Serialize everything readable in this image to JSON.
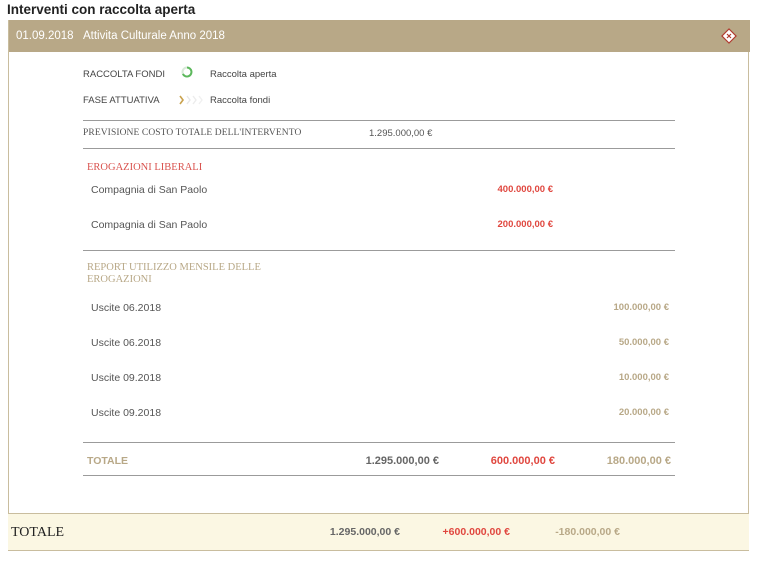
{
  "page_title": "Interventi con raccolta aperta",
  "card": {
    "date": "01.09.2018",
    "title": "Attivita Culturale Anno 2018",
    "status_rows": [
      {
        "label": "RACCOLTA FONDI",
        "value": "Raccolta aperta",
        "icon": "progress-ring-icon"
      },
      {
        "label": "FASE ATTUATIVA",
        "value": "Raccolta fondi",
        "icon": "chevron-steps-icon"
      }
    ],
    "forecast": {
      "label": "PREVISIONE COSTO TOTALE DELL'INTERVENTO",
      "value": "1.295.000,00 €"
    },
    "donations": {
      "title": "EROGAZIONI LIBERALI",
      "items": [
        {
          "label": "Compagnia di San Paolo",
          "amount": "400.000,00 €"
        },
        {
          "label": "Compagnia di San Paolo",
          "amount": "200.000,00 €"
        }
      ]
    },
    "report": {
      "title": "REPORT UTILIZZO MENSILE DELLE EROGAZIONI",
      "items": [
        {
          "label": "Uscite 06.2018",
          "amount": "100.000,00 €"
        },
        {
          "label": "Uscite 06.2018",
          "amount": "50.000,00 €"
        },
        {
          "label": "Uscite 09.2018",
          "amount": "10.000,00 €"
        },
        {
          "label": "Uscite 09.2018",
          "amount": "20.000,00 €"
        }
      ]
    },
    "totals": {
      "label": "TOTALE",
      "forecast": "1.295.000,00 €",
      "donations": "600.000,00 €",
      "used": "180.000,00 €"
    }
  },
  "footer": {
    "label": "TOTALE",
    "forecast": "1.295.000,00 €",
    "donations": "+600.000,00 €",
    "used": "-180.000,00 €"
  },
  "colors": {
    "header_bg": "#b8a887",
    "red": "#e0473f",
    "gold": "#b8a887",
    "footer_bg": "#fbf7e3",
    "ring_green": "#5cb85c"
  }
}
